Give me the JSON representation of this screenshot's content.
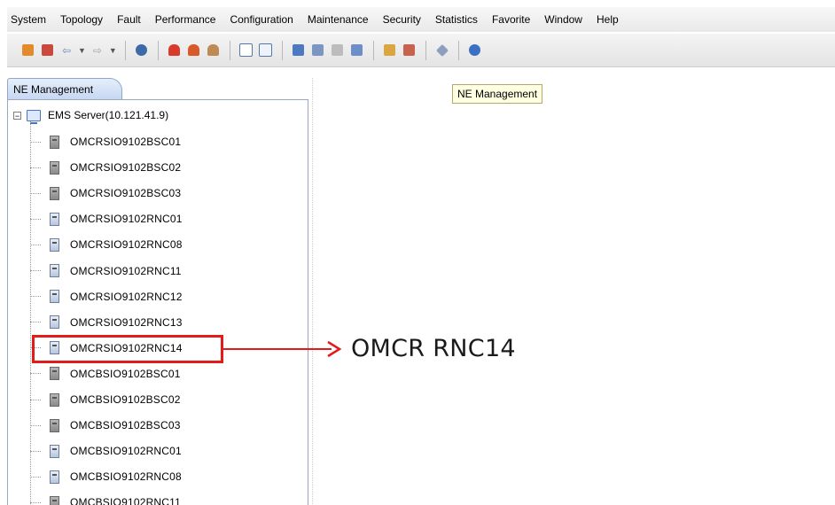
{
  "menu": [
    "System",
    "Topology",
    "Fault",
    "Performance",
    "Configuration",
    "Maintenance",
    "Security",
    "Statistics",
    "Favorite",
    "Window",
    "Help"
  ],
  "colors": {
    "accent_red": "#e21b1b",
    "tab_blue": "#c7d8f3",
    "tooltip_bg": "#ffffe1"
  },
  "left_tab": {
    "label": "NE Management"
  },
  "tree": {
    "root": "EMS Server(10.121.41.9)",
    "nodes": [
      {
        "label": "OMCRSIO9102BSC01",
        "kind": "bsc"
      },
      {
        "label": "OMCRSIO9102BSC02",
        "kind": "bsc"
      },
      {
        "label": "OMCRSIO9102BSC03",
        "kind": "bsc"
      },
      {
        "label": "OMCRSIO9102RNC01",
        "kind": "rnc"
      },
      {
        "label": "OMCRSIO9102RNC08",
        "kind": "rnc"
      },
      {
        "label": "OMCRSIO9102RNC11",
        "kind": "rnc"
      },
      {
        "label": "OMCRSIO9102RNC12",
        "kind": "rnc"
      },
      {
        "label": "OMCRSIO9102RNC13",
        "kind": "rnc"
      },
      {
        "label": "OMCRSIO9102RNC14",
        "kind": "rnc"
      },
      {
        "label": "OMCBSIO9102BSC01",
        "kind": "bsc"
      },
      {
        "label": "OMCBSIO9102BSC02",
        "kind": "bsc"
      },
      {
        "label": "OMCBSIO9102BSC03",
        "kind": "bsc"
      },
      {
        "label": "OMCBSIO9102RNC01",
        "kind": "rnc"
      },
      {
        "label": "OMCBSIO9102RNC08",
        "kind": "rnc"
      },
      {
        "label": "OMCBSIO9102RNC11",
        "kind": "bsc"
      }
    ]
  },
  "tooltip": "NE Management",
  "annotation": {
    "text": "OMCR RNC14"
  }
}
